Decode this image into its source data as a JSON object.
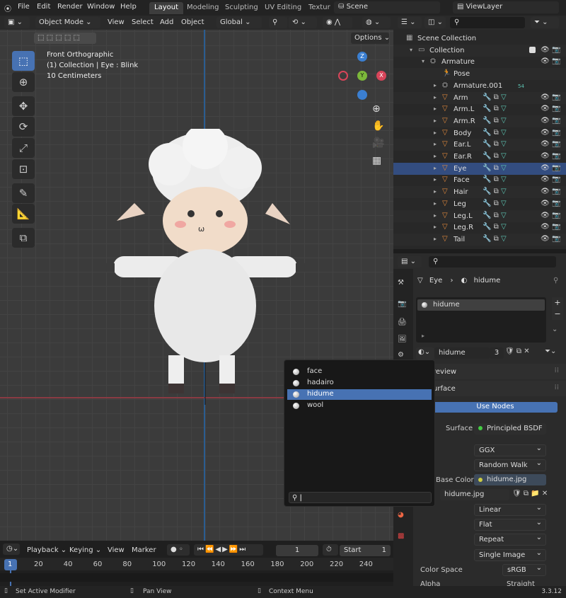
{
  "menu": [
    "File",
    "Edit",
    "Render",
    "Window",
    "Help"
  ],
  "workspaces": [
    "Layout",
    "Modeling",
    "Sculpting",
    "UV Editing",
    "Textur"
  ],
  "scene": "Scene",
  "view_layer": "ViewLayer",
  "viewport": {
    "mode": "Object Mode",
    "menus": [
      "View",
      "Select",
      "Add",
      "Object"
    ],
    "transform": "Global",
    "options": "Options",
    "info": [
      "Front Orthographic",
      "(1) Collection | Eye : Blink",
      "10 Centimeters"
    ],
    "gizmo": {
      "z": "Z",
      "y": "Y",
      "x": "X"
    }
  },
  "outliner": {
    "rows": [
      {
        "name": "Scene Collection",
        "indent": 0
      },
      {
        "name": "Collection",
        "indent": 1
      },
      {
        "name": "Armature",
        "indent": 2
      },
      {
        "name": "Pose",
        "indent": 3
      },
      {
        "name": "Armature.001",
        "indent": 3,
        "badge": "54"
      },
      {
        "name": "Arm",
        "indent": 3
      },
      {
        "name": "Arm.L",
        "indent": 3
      },
      {
        "name": "Arm.R",
        "indent": 3
      },
      {
        "name": "Body",
        "indent": 3
      },
      {
        "name": "Ear.L",
        "indent": 3
      },
      {
        "name": "Ear.R",
        "indent": 3
      },
      {
        "name": "Eye",
        "indent": 3,
        "selected": true
      },
      {
        "name": "Face",
        "indent": 3
      },
      {
        "name": "Hair",
        "indent": 3
      },
      {
        "name": "Leg",
        "indent": 3
      },
      {
        "name": "Leg.L",
        "indent": 3
      },
      {
        "name": "Leg.R",
        "indent": 3
      },
      {
        "name": "Tail",
        "indent": 3
      }
    ]
  },
  "properties": {
    "breadcrumb_object": "Eye",
    "breadcrumb_material": "hidume",
    "slot": "hidume",
    "material_name": "hidume",
    "users": "3",
    "preview": "review",
    "surface_title": "urface",
    "use_nodes": "Use Nodes",
    "surface_label": "Surface",
    "surface_value": "Principled BSDF",
    "distribution": "GGX",
    "subsurface": "Random Walk",
    "base_color_label": "Base Color",
    "base_color_value": "hidume.jpg",
    "image": "hidume.jpg",
    "interp": "Linear",
    "projection": "Flat",
    "extension": "Repeat",
    "source": "Single Image",
    "color_space_label": "Color Space",
    "color_space": "sRGB",
    "alpha_label": "Alpha",
    "alpha_value": "Straight"
  },
  "popup": {
    "items": [
      "face",
      "hadairo",
      "hidume",
      "wool"
    ],
    "selected": "hidume",
    "search_value": ""
  },
  "timeline": {
    "menus": [
      "Playback",
      "Keying",
      "View",
      "Marker"
    ],
    "frame": "1",
    "start_label": "Start",
    "start": "1",
    "ticks": [
      "1",
      "20",
      "40",
      "60",
      "80",
      "100",
      "120",
      "140",
      "160",
      "180",
      "200",
      "220",
      "240"
    ]
  },
  "status": {
    "left": "Set Active Modifier",
    "mid": "Pan View",
    "right": "Context Menu",
    "version": "3.3.12"
  }
}
